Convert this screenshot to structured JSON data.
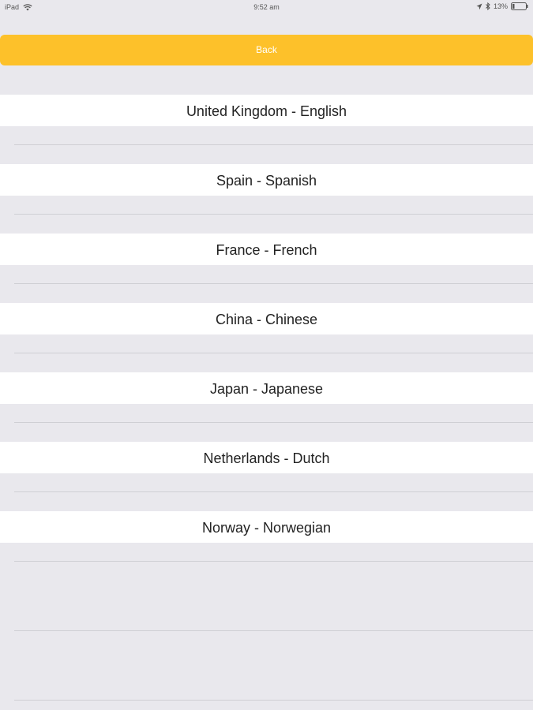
{
  "status_bar": {
    "device": "iPad",
    "time": "9:52 am",
    "battery": "13%",
    "icons": [
      "wifi-icon",
      "location-icon",
      "bluetooth-icon",
      "battery-icon"
    ]
  },
  "back_button": {
    "label": "Back",
    "color": "#fdc12a"
  },
  "languages": [
    {
      "label": "United Kingdom - English"
    },
    {
      "label": "Spain - Spanish"
    },
    {
      "label": "France - French"
    },
    {
      "label": "China - Chinese"
    },
    {
      "label": "Japan - Japanese"
    },
    {
      "label": "Netherlands - Dutch"
    },
    {
      "label": "Norway - Norwegian"
    }
  ]
}
